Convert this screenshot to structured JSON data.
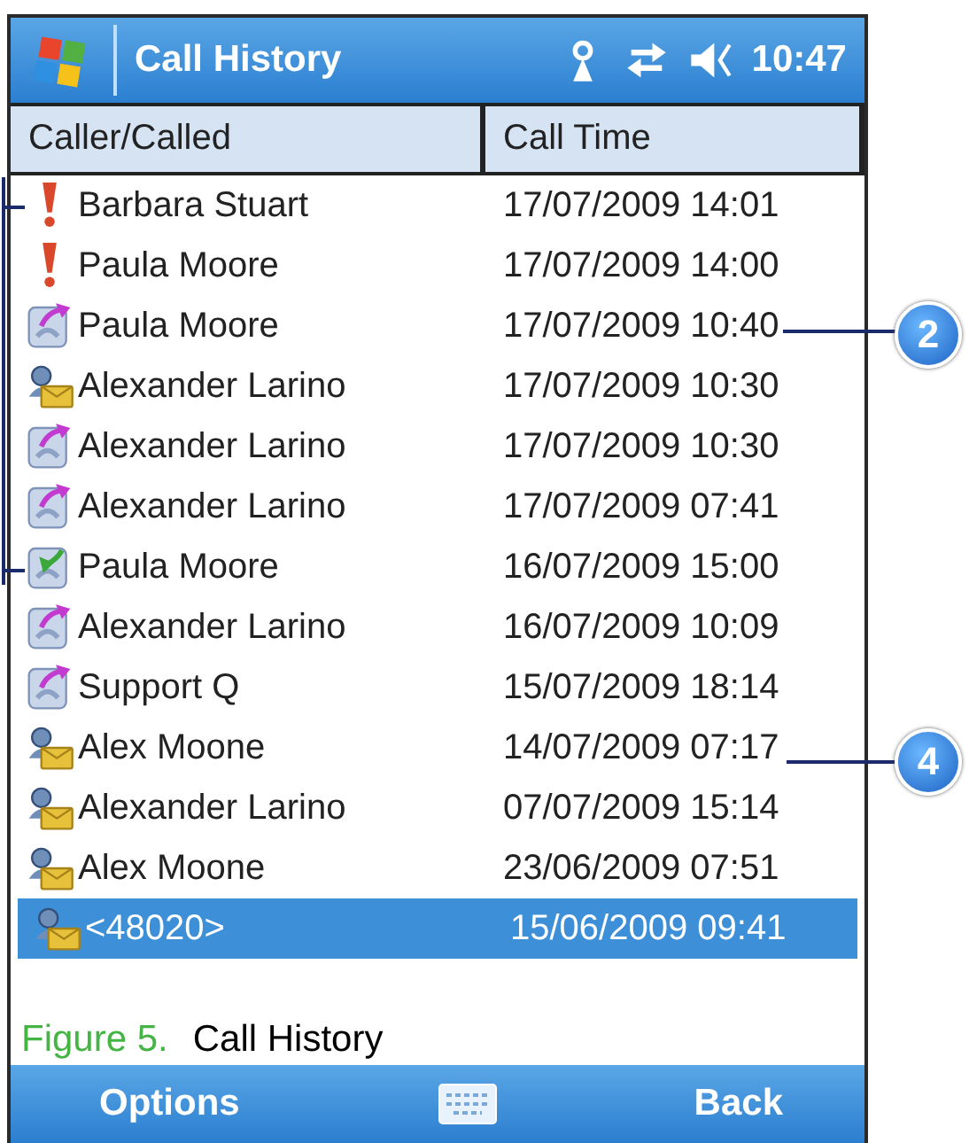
{
  "title_bar": {
    "title": "Call History",
    "time": "10:47"
  },
  "table": {
    "columns": [
      "Caller/Called",
      "Call Time"
    ],
    "rows": [
      {
        "kind": "missed",
        "name": "Barbara Stuart",
        "time": "17/07/2009 14:01",
        "selected": false
      },
      {
        "kind": "missed",
        "name": "Paula Moore",
        "time": "17/07/2009 14:00",
        "selected": false
      },
      {
        "kind": "outgoing",
        "name": "Paula Moore",
        "time": "17/07/2009 10:40",
        "selected": false
      },
      {
        "kind": "contact",
        "name": "Alexander Larino",
        "time": "17/07/2009 10:30",
        "selected": false
      },
      {
        "kind": "outgoing",
        "name": "Alexander Larino",
        "time": "17/07/2009 10:30",
        "selected": false
      },
      {
        "kind": "outgoing",
        "name": "Alexander Larino",
        "time": "17/07/2009 07:41",
        "selected": false
      },
      {
        "kind": "incoming",
        "name": "Paula Moore",
        "time": "16/07/2009 15:00",
        "selected": false
      },
      {
        "kind": "outgoing",
        "name": "Alexander Larino",
        "time": "16/07/2009 10:09",
        "selected": false
      },
      {
        "kind": "outgoing",
        "name": "Support Q",
        "time": "15/07/2009 18:14",
        "selected": false
      },
      {
        "kind": "contact",
        "name": "Alex Moone",
        "time": "14/07/2009 07:17",
        "selected": false
      },
      {
        "kind": "contact",
        "name": "Alexander Larino",
        "time": "07/07/2009 15:14",
        "selected": false
      },
      {
        "kind": "contact",
        "name": "Alex Moone",
        "time": "23/06/2009 07:51",
        "selected": false
      },
      {
        "kind": "contact",
        "name": "<48020>",
        "time": "15/06/2009 09:41",
        "selected": true
      }
    ]
  },
  "caption": {
    "label": "Figure 5.",
    "title": "Call History"
  },
  "softkeys": [
    "Options",
    "Back"
  ],
  "callouts": [
    {
      "number": "2"
    },
    {
      "number": "4"
    }
  ]
}
